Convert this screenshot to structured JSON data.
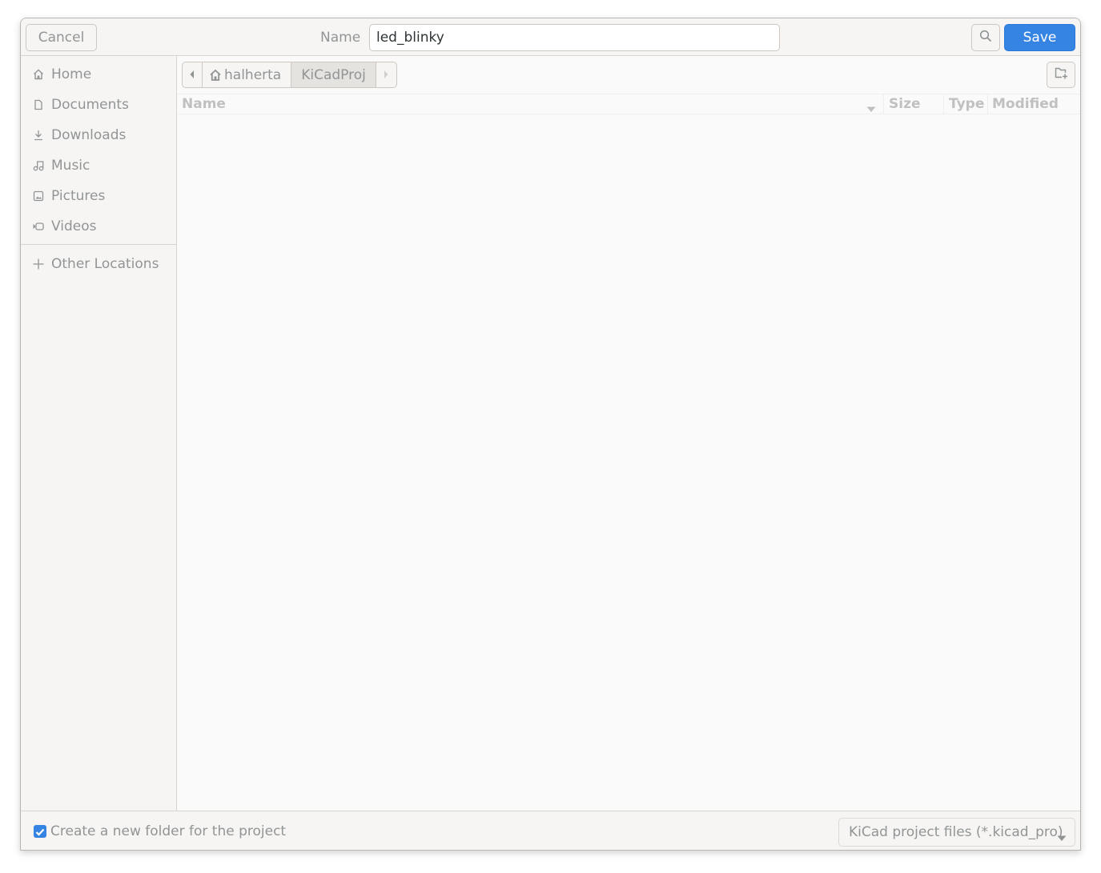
{
  "header": {
    "cancel_label": "Cancel",
    "name_label": "Name",
    "name_value": "led_blinky",
    "search_icon": "search-icon",
    "save_label": "Save"
  },
  "sidebar": {
    "items": [
      {
        "label": "Home",
        "icon": "home-icon"
      },
      {
        "label": "Documents",
        "icon": "document-icon"
      },
      {
        "label": "Downloads",
        "icon": "download-icon"
      },
      {
        "label": "Music",
        "icon": "music-icon"
      },
      {
        "label": "Pictures",
        "icon": "picture-icon"
      },
      {
        "label": "Videos",
        "icon": "video-icon"
      }
    ],
    "other_locations": {
      "label": "Other Locations",
      "icon": "plus-icon"
    }
  },
  "pathbar": {
    "segments": [
      "halherta",
      "KiCadProj"
    ],
    "current": "KiCadProj"
  },
  "file_list": {
    "columns": [
      "Name",
      "Size",
      "Type",
      "Modified"
    ],
    "sort_column": "Name",
    "rows": []
  },
  "footer": {
    "checkbox_label": "Create a new folder for the project",
    "checkbox_checked": true,
    "filter_selected": "KiCad project files (*.kicad_pro)"
  },
  "colors": {
    "accent": "#3584e4",
    "background": "#f6f5f4",
    "list_background": "#fafafa"
  }
}
